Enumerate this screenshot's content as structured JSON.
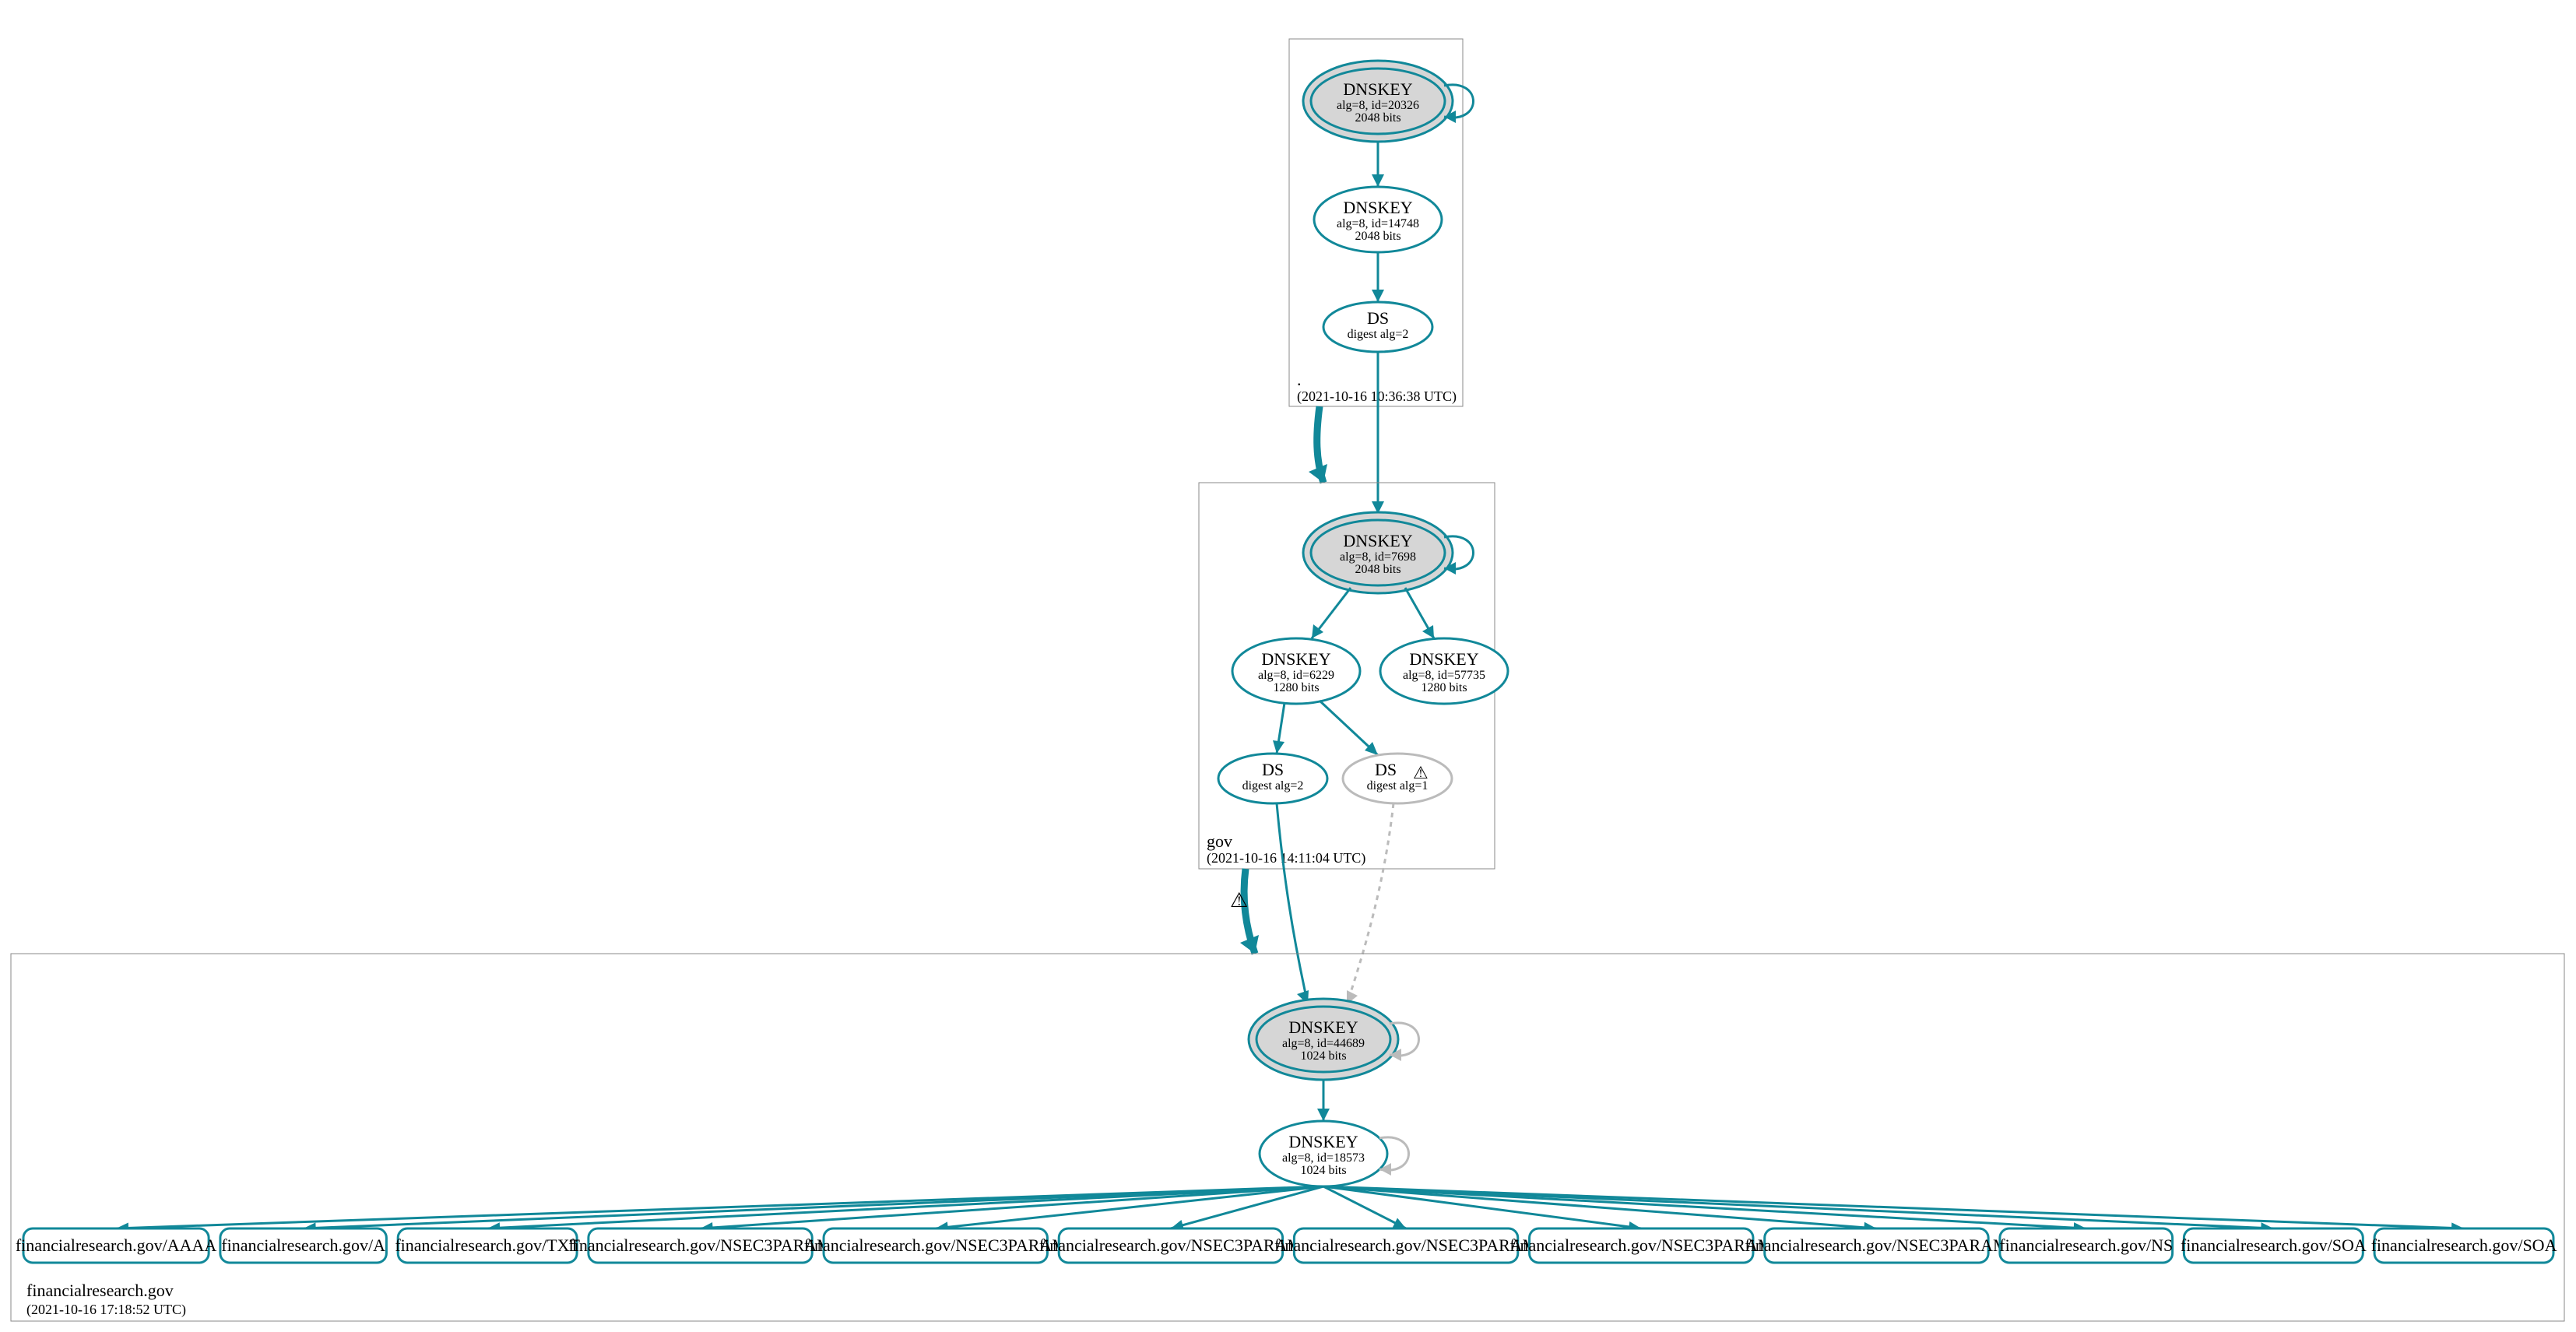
{
  "colors": {
    "teal": "#118899",
    "grayFill": "#d6d6d6",
    "lightGray": "#bbbbbb",
    "boxStroke": "#888888"
  },
  "zones": {
    "root": {
      "label": ".",
      "timestamp": "(2021-10-16 10:36:38 UTC)"
    },
    "gov": {
      "label": "gov",
      "timestamp": "(2021-10-16 14:11:04 UTC)"
    },
    "fr": {
      "label": "financialresearch.gov",
      "timestamp": "(2021-10-16 17:18:52 UTC)"
    }
  },
  "nodes": {
    "rootKSK": {
      "title": "DNSKEY",
      "l2": "alg=8, id=20326",
      "l3": "2048 bits"
    },
    "rootZSK": {
      "title": "DNSKEY",
      "l2": "alg=8, id=14748",
      "l3": "2048 bits"
    },
    "rootDS": {
      "title": "DS",
      "l2": "digest alg=2"
    },
    "govKSK": {
      "title": "DNSKEY",
      "l2": "alg=8, id=7698",
      "l3": "2048 bits"
    },
    "govZSK1": {
      "title": "DNSKEY",
      "l2": "alg=8, id=6229",
      "l3": "1280 bits"
    },
    "govZSK2": {
      "title": "DNSKEY",
      "l2": "alg=8, id=57735",
      "l3": "1280 bits"
    },
    "govDS1": {
      "title": "DS",
      "l2": "digest alg=2"
    },
    "govDS2": {
      "title": "DS",
      "l2": "digest alg=1"
    },
    "frKSK": {
      "title": "DNSKEY",
      "l2": "alg=8, id=44689",
      "l3": "1024 bits"
    },
    "frZSK": {
      "title": "DNSKEY",
      "l2": "alg=8, id=18573",
      "l3": "1024 bits"
    }
  },
  "rrsets": [
    "financialresearch.gov/AAAA",
    "financialresearch.gov/A",
    "financialresearch.gov/TXT",
    "financialresearch.gov/NSEC3PARAM",
    "financialresearch.gov/NSEC3PARAM",
    "financialresearch.gov/NSEC3PARAM",
    "financialresearch.gov/NSEC3PARAM",
    "financialresearch.gov/NSEC3PARAM",
    "financialresearch.gov/NSEC3PARAM",
    "financialresearch.gov/NS",
    "financialresearch.gov/SOA",
    "financialresearch.gov/SOA"
  ],
  "warningIcon": "⚠"
}
